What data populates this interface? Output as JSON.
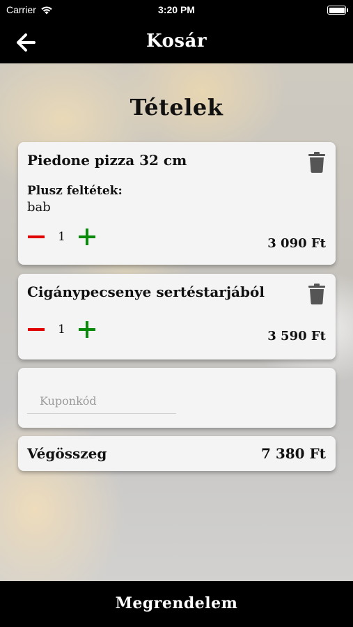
{
  "status_bar": {
    "carrier": "Carrier",
    "time": "3:20 PM",
    "wifi_icon": "wifi-icon",
    "battery_icon": "battery-icon"
  },
  "nav": {
    "back_icon": "back-arrow-icon",
    "title": "Kosár"
  },
  "main": {
    "section_title": "Tételek",
    "items": [
      {
        "name": "Piedone pizza 32 cm",
        "extras_label": "Plusz feltétek:",
        "extras_value": "bab",
        "quantity": "1",
        "price": "3 090 Ft"
      },
      {
        "name": "Cigánypecsenye sertéstarjából",
        "quantity": "1",
        "price": "3 590 Ft"
      }
    ],
    "coupon": {
      "placeholder": "Kuponkód",
      "value": ""
    },
    "total": {
      "label": "Végösszeg",
      "value": "7 380 Ft"
    }
  },
  "footer": {
    "order_button": "Megrendelem"
  },
  "colors": {
    "minus": "#e00000",
    "plus": "#0a8a0a",
    "trash": "#555555",
    "bars": "#000000"
  }
}
